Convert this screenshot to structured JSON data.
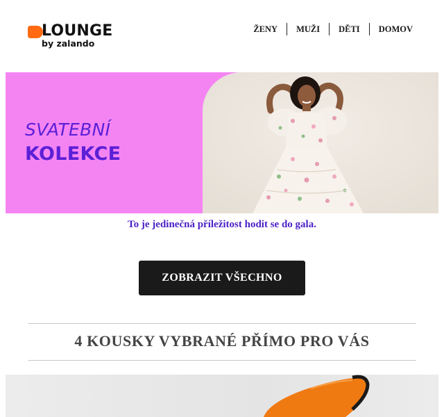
{
  "brand": {
    "name": "LOUNGE",
    "sub": "by zalando",
    "accent": "#ff6a13"
  },
  "nav": {
    "items": [
      "ŽENY",
      "MUŽI",
      "DĚTI",
      "DOMOV"
    ]
  },
  "hero": {
    "line1": "SVATEBNÍ",
    "line2": "KOLEKCE",
    "bg_color": "#f584f3",
    "text_color": "#5b20d6"
  },
  "tagline": "To je jedinečná příležitost hodit se do gala.",
  "cta": {
    "label": "ZOBRAZIT VŠECHNO"
  },
  "section": {
    "title": "4 KOUSKY VYBRANÉ PŘÍMO PRO VÁS"
  }
}
